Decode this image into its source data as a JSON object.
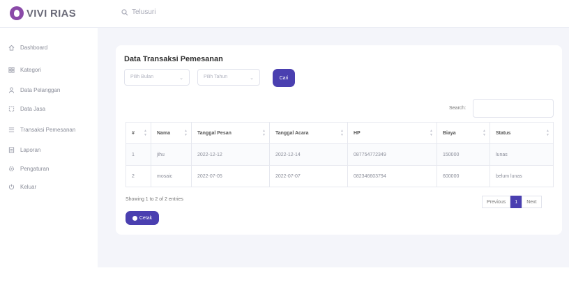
{
  "brand": {
    "name": "VIVI RIAS"
  },
  "header": {
    "search_placeholder": "Telusuri"
  },
  "sidebar": {
    "items": [
      {
        "label": "Dashboard",
        "icon": "home-icon"
      },
      {
        "label": "Kategori",
        "icon": "grid-icon"
      },
      {
        "label": "Data Pelanggan",
        "icon": "user-icon"
      },
      {
        "label": "Data Jasa",
        "icon": "box-icon"
      },
      {
        "label": "Transaksi Pemesanan",
        "icon": "list-icon"
      },
      {
        "label": "Laporan",
        "icon": "report-icon"
      },
      {
        "label": "Pengaturan",
        "icon": "gear-icon"
      },
      {
        "label": "Keluar",
        "icon": "logout-icon"
      }
    ]
  },
  "card": {
    "title": "Data Transaksi Pemesanan",
    "filter_month": "Pilih Bulan",
    "filter_year": "Pilih Tahun",
    "search_button": "Cari",
    "search_label": "Search:",
    "columns": [
      "#",
      "Nama",
      "Tanggal Pesan",
      "Tanggal Acara",
      "HP",
      "Biaya",
      "Status"
    ],
    "rows": [
      {
        "no": "1",
        "nama": "jihu",
        "tanggal_pesan": "2022-12-12",
        "tanggal_acara": "2022-12-14",
        "hp": "087754772349",
        "biaya": "150000",
        "status": "lunas"
      },
      {
        "no": "2",
        "nama": "mosaic",
        "tanggal_pesan": "2022-07-05",
        "tanggal_acara": "2022-07-07",
        "hp": "082346603794",
        "biaya": "600000",
        "status": "belum lunas"
      }
    ],
    "info": "Showing 1 to 2 of 2 entries",
    "pager": {
      "previous": "Previous",
      "current": "1",
      "next": "Next"
    },
    "print_button": "Cetak"
  },
  "colors": {
    "accent": "#4a3fb0",
    "brand": "#8a4aa8",
    "background": "#f4f5fa"
  }
}
